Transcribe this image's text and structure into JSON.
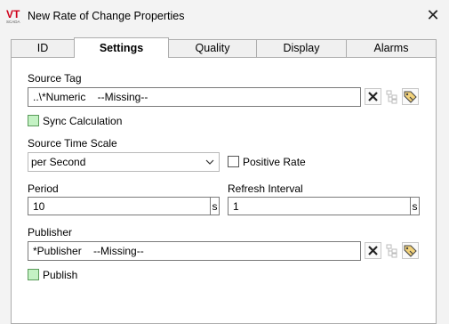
{
  "window": {
    "title": "New Rate of Change Properties",
    "logo_text": "VT",
    "logo_subtext": "SCADA"
  },
  "tabs": [
    {
      "label": "ID",
      "active": false
    },
    {
      "label": "Settings",
      "active": true
    },
    {
      "label": "Quality",
      "active": false
    },
    {
      "label": "Display",
      "active": false
    },
    {
      "label": "Alarms",
      "active": false
    }
  ],
  "source_tag": {
    "label": "Source Tag",
    "value": "..\\*Numeric    --Missing--",
    "icons": [
      "clear-x-icon",
      "tag-browse-disabled-icon",
      "tag-select-icon"
    ]
  },
  "sync_calculation": {
    "label": "Sync Calculation",
    "checked": false
  },
  "source_time_scale": {
    "label": "Source Time Scale",
    "selected": "per Second"
  },
  "positive_rate": {
    "label": "Positive Rate",
    "checked": false
  },
  "period": {
    "label": "Period",
    "value": "10",
    "unit": "s"
  },
  "refresh_interval": {
    "label": "Refresh Interval",
    "value": "1",
    "unit": "s"
  },
  "publisher": {
    "label": "Publisher",
    "value": "*Publisher    --Missing--",
    "icons": [
      "clear-x-icon",
      "tag-browse-disabled-icon",
      "tag-select-icon"
    ]
  },
  "publish": {
    "label": "Publish",
    "checked": false
  },
  "colors": {
    "accent_green": "#c4f2c4",
    "logo_red": "#d0021b"
  }
}
